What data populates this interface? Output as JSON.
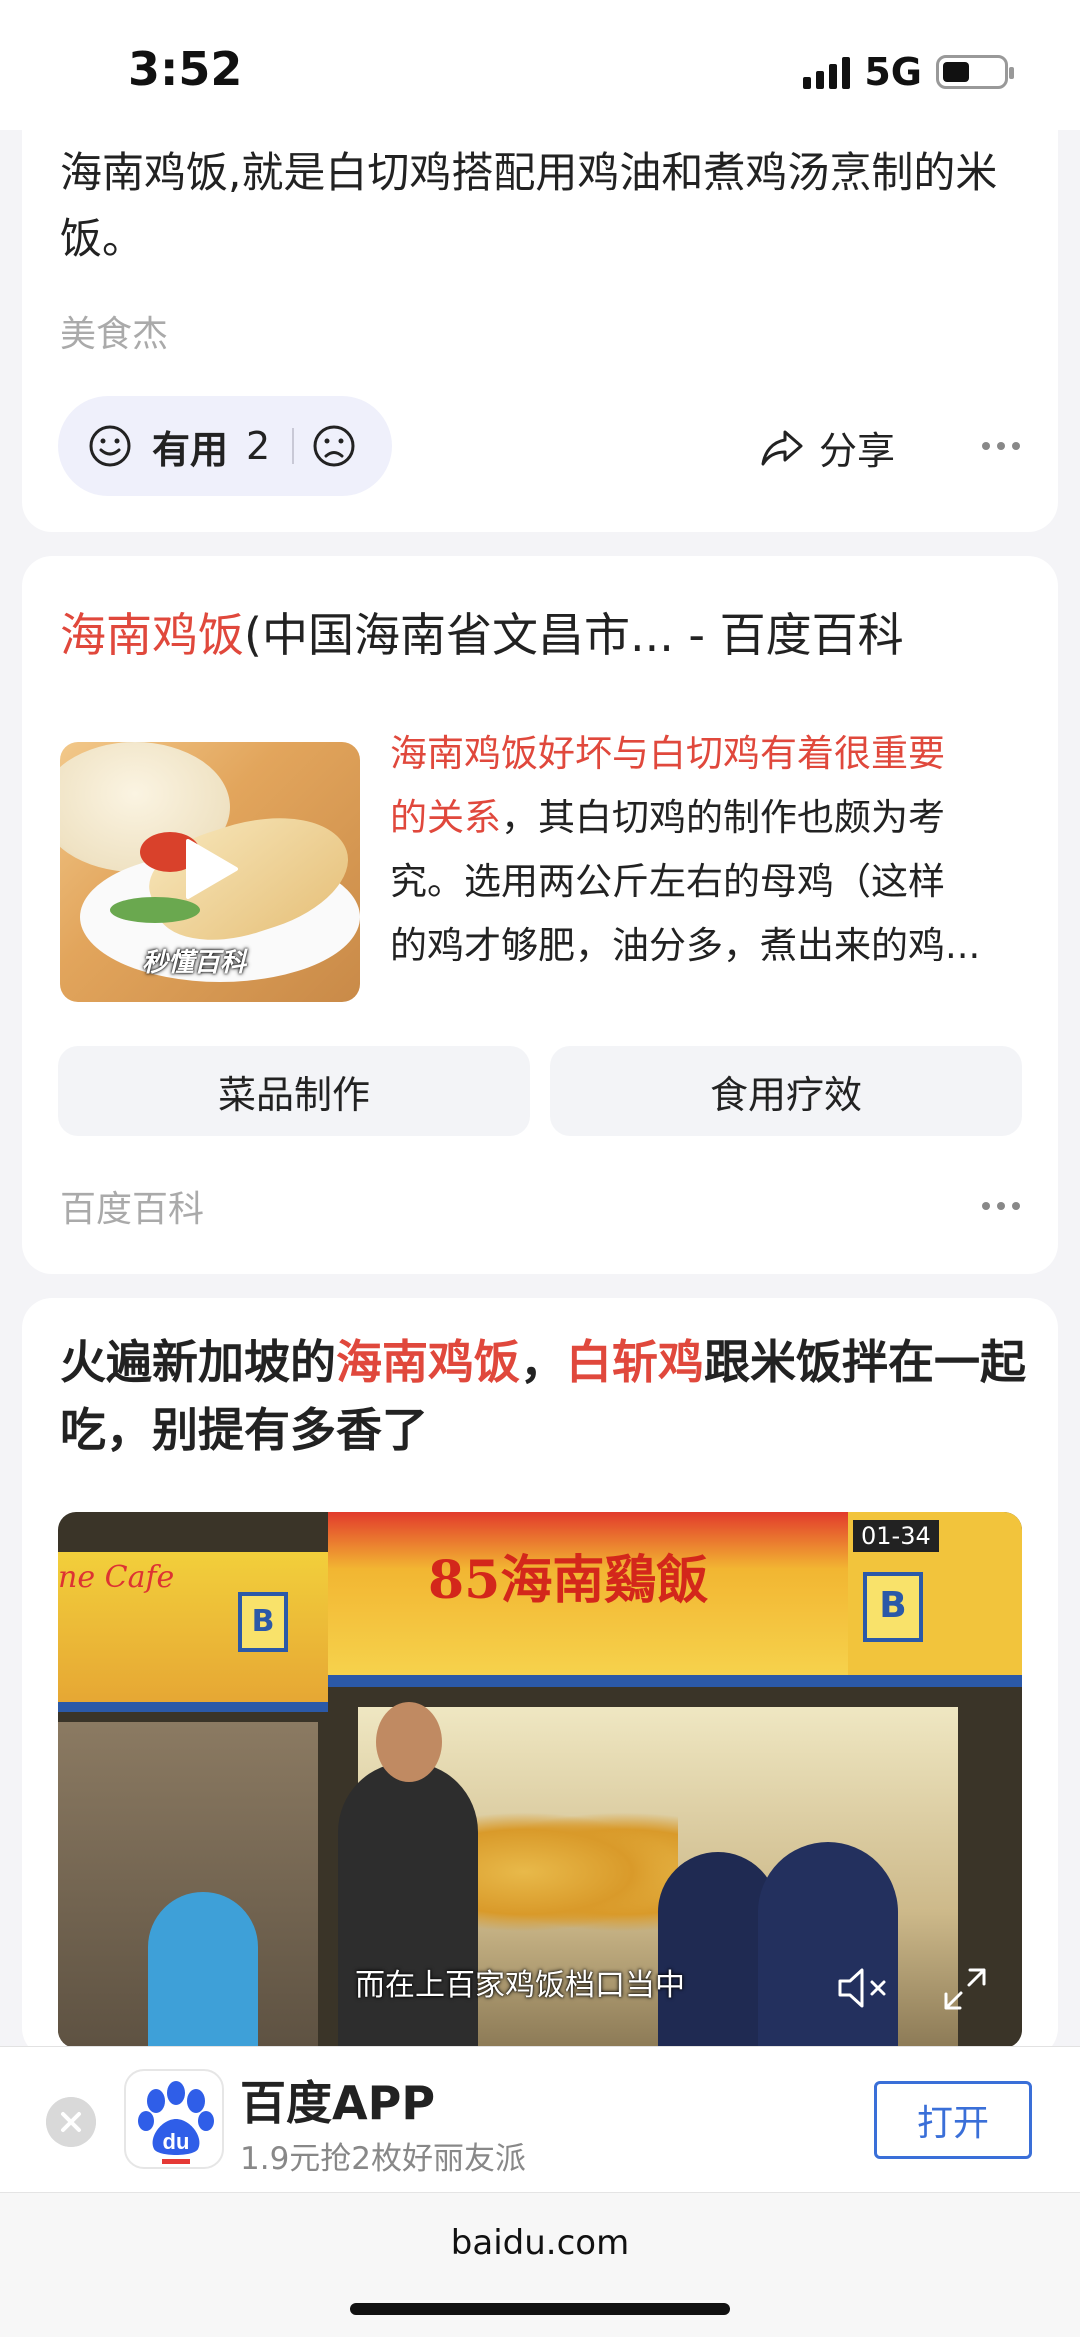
{
  "status_bar": {
    "time": "3:52",
    "network": "5G"
  },
  "answer_card": {
    "text": " 海南鸡饭,就是白切鸡搭配用鸡油和煮鸡汤烹制的米饭。",
    "source": "美食杰",
    "useful_label": "有用",
    "useful_count": "2",
    "share_label": "分享"
  },
  "baike_card": {
    "title_highlight": "海南鸡饭",
    "title_rest": "(中国海南省文昌市... - 百度百科",
    "summary_lines": [
      {
        "highlight": "海南鸡饭好坏与白切鸡有着很重要",
        "rest": ""
      },
      {
        "highlight": "的关系",
        "rest": "，其白切鸡的制作也颇为考"
      },
      {
        "highlight": "",
        "rest": "究。选用两公斤左右的母鸡（这样"
      },
      {
        "highlight": "",
        "rest": "的鸡才够肥，油分多，煮出来的鸡..."
      }
    ],
    "thumb_brand": "秒懂百科",
    "tags": [
      "菜品制作",
      "食用疗效"
    ],
    "source": "百度百科"
  },
  "video_card": {
    "title_parts": [
      "火遍新加坡的",
      "海南鸡饭",
      "，",
      "白斩鸡",
      "跟米饭拌在一起吃，别提有多香了"
    ],
    "sign_text": "85海南鷄飯",
    "cafe_text": "ne Cafe",
    "stall_number": "01-34",
    "stall_letter": "B",
    "subtitle": "而在上百家鸡饭档口当中"
  },
  "app_banner": {
    "name": "百度APP",
    "promo": "1.9元抢2枚好丽友派",
    "open_label": "打开"
  },
  "url_bar": {
    "url": "baidu.com"
  },
  "colors": {
    "highlight": "#e0483c",
    "accent_blue": "#3a6fd8",
    "feedback_bg": "#eff0fb"
  }
}
